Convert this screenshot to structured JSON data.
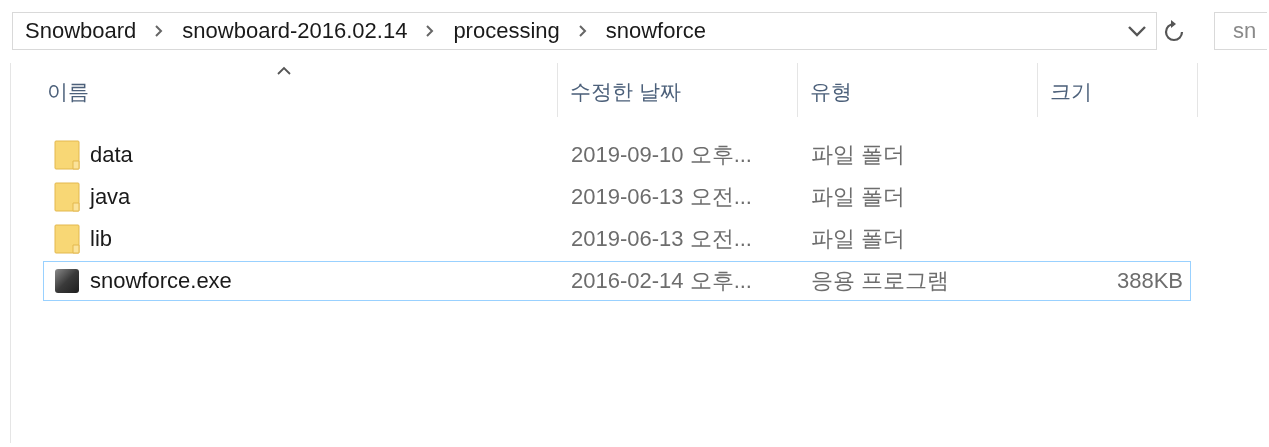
{
  "address_bar": {
    "path": [
      {
        "label": "Snowboard"
      },
      {
        "label": "snowboard-2016.02.14"
      },
      {
        "label": "processing"
      },
      {
        "label": "snowforce"
      }
    ]
  },
  "search": {
    "placeholder": "sn"
  },
  "columns": [
    {
      "label": "이름",
      "sorted": true
    },
    {
      "label": "수정한 날짜",
      "sorted": false
    },
    {
      "label": "유형",
      "sorted": false
    },
    {
      "label": "크기",
      "sorted": false
    }
  ],
  "rows": [
    {
      "kind": "folder",
      "name": "data",
      "modified": "2019-09-10 오후...",
      "type": "파일 폴더",
      "focused": false
    },
    {
      "kind": "folder",
      "name": "java",
      "modified": "2019-06-13 오전...",
      "type": "파일 폴더",
      "focused": false
    },
    {
      "kind": "folder",
      "name": "lib",
      "modified": "2019-06-13 오전...",
      "type": "파일 폴더",
      "focused": false
    },
    {
      "kind": "app",
      "name": "snowforce.exe",
      "modified": "2016-02-14 오후...",
      "type": "응용 프로그램",
      "size": "388KB",
      "focused": true
    }
  ]
}
